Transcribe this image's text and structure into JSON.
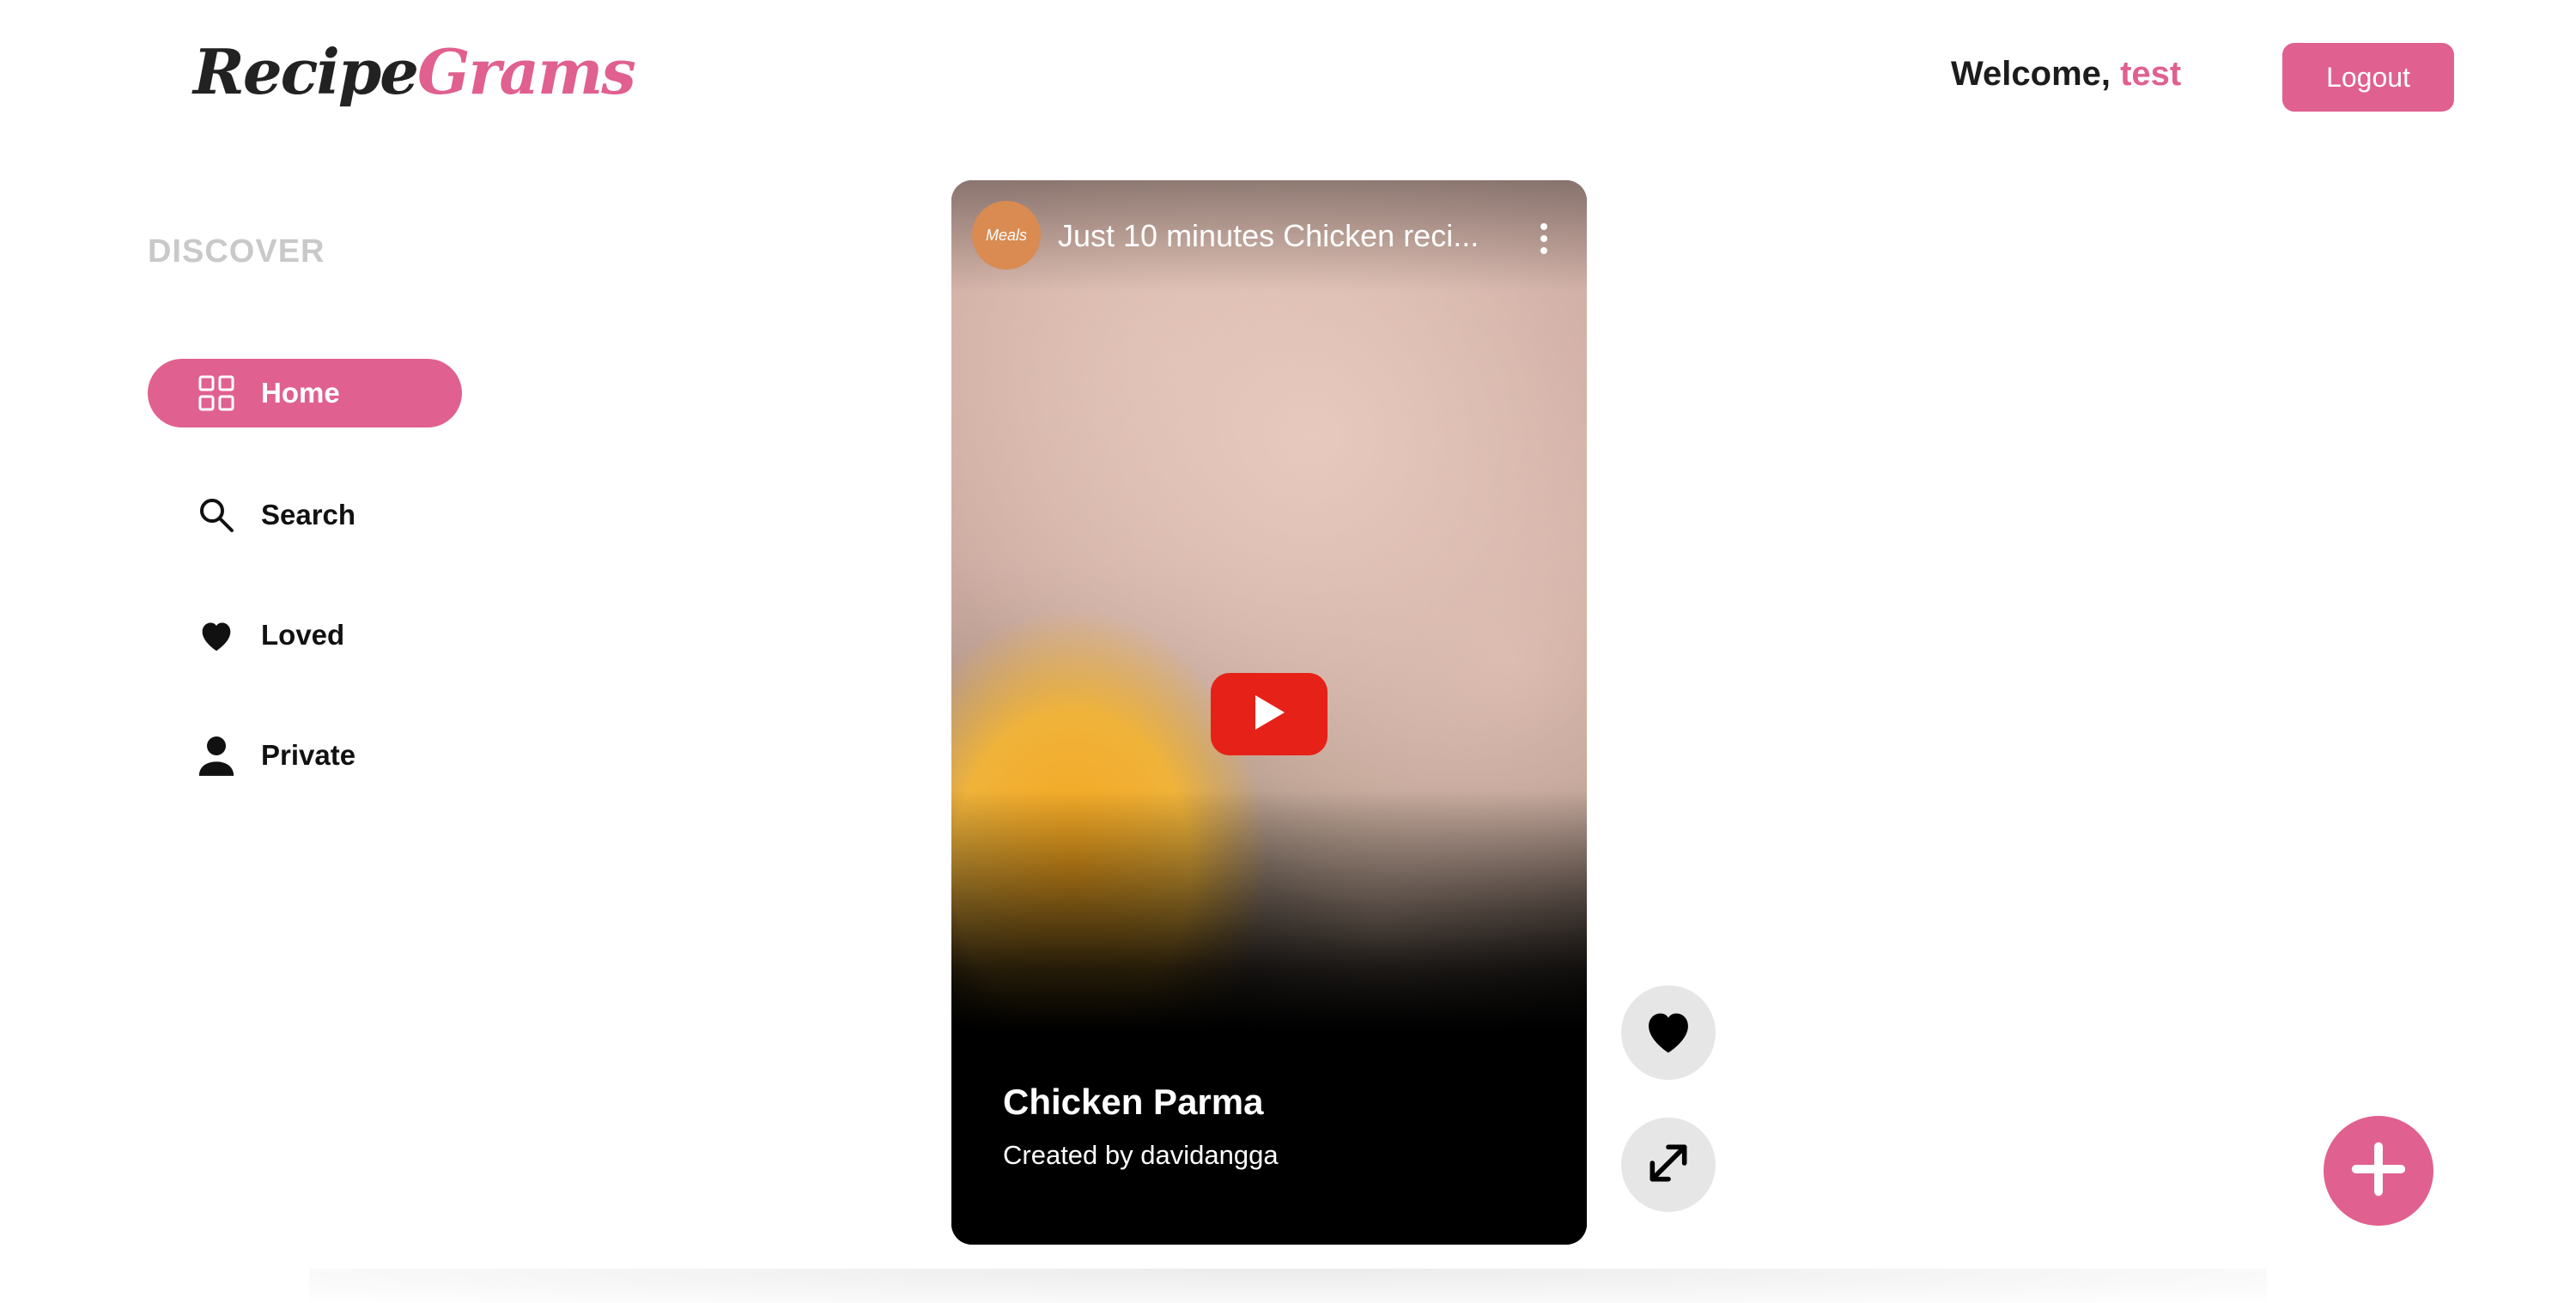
{
  "app": {
    "logo_part1": "Recipe",
    "logo_part2": "Grams"
  },
  "header": {
    "welcome_text": "Welcome, ",
    "username": "test",
    "logout_label": "Logout"
  },
  "sidebar": {
    "section_title": "DISCOVER",
    "items": [
      {
        "label": "Home",
        "icon": "grid-icon",
        "active": true
      },
      {
        "label": "Search",
        "icon": "search-icon",
        "active": false
      },
      {
        "label": "Loved",
        "icon": "heart-icon",
        "active": false
      },
      {
        "label": "Private",
        "icon": "person-icon",
        "active": false
      }
    ]
  },
  "video": {
    "title": "Just 10 minutes Chicken reci...",
    "channel_avatar_text": "Meals"
  },
  "recipe": {
    "title": "Chicken Parma",
    "author": "Created by davidangga"
  },
  "actions": {
    "love": "heart-icon",
    "expand": "expand-icon",
    "add": "plus-icon"
  },
  "colors": {
    "accent": "#e0608f",
    "play_button": "#e62117"
  }
}
